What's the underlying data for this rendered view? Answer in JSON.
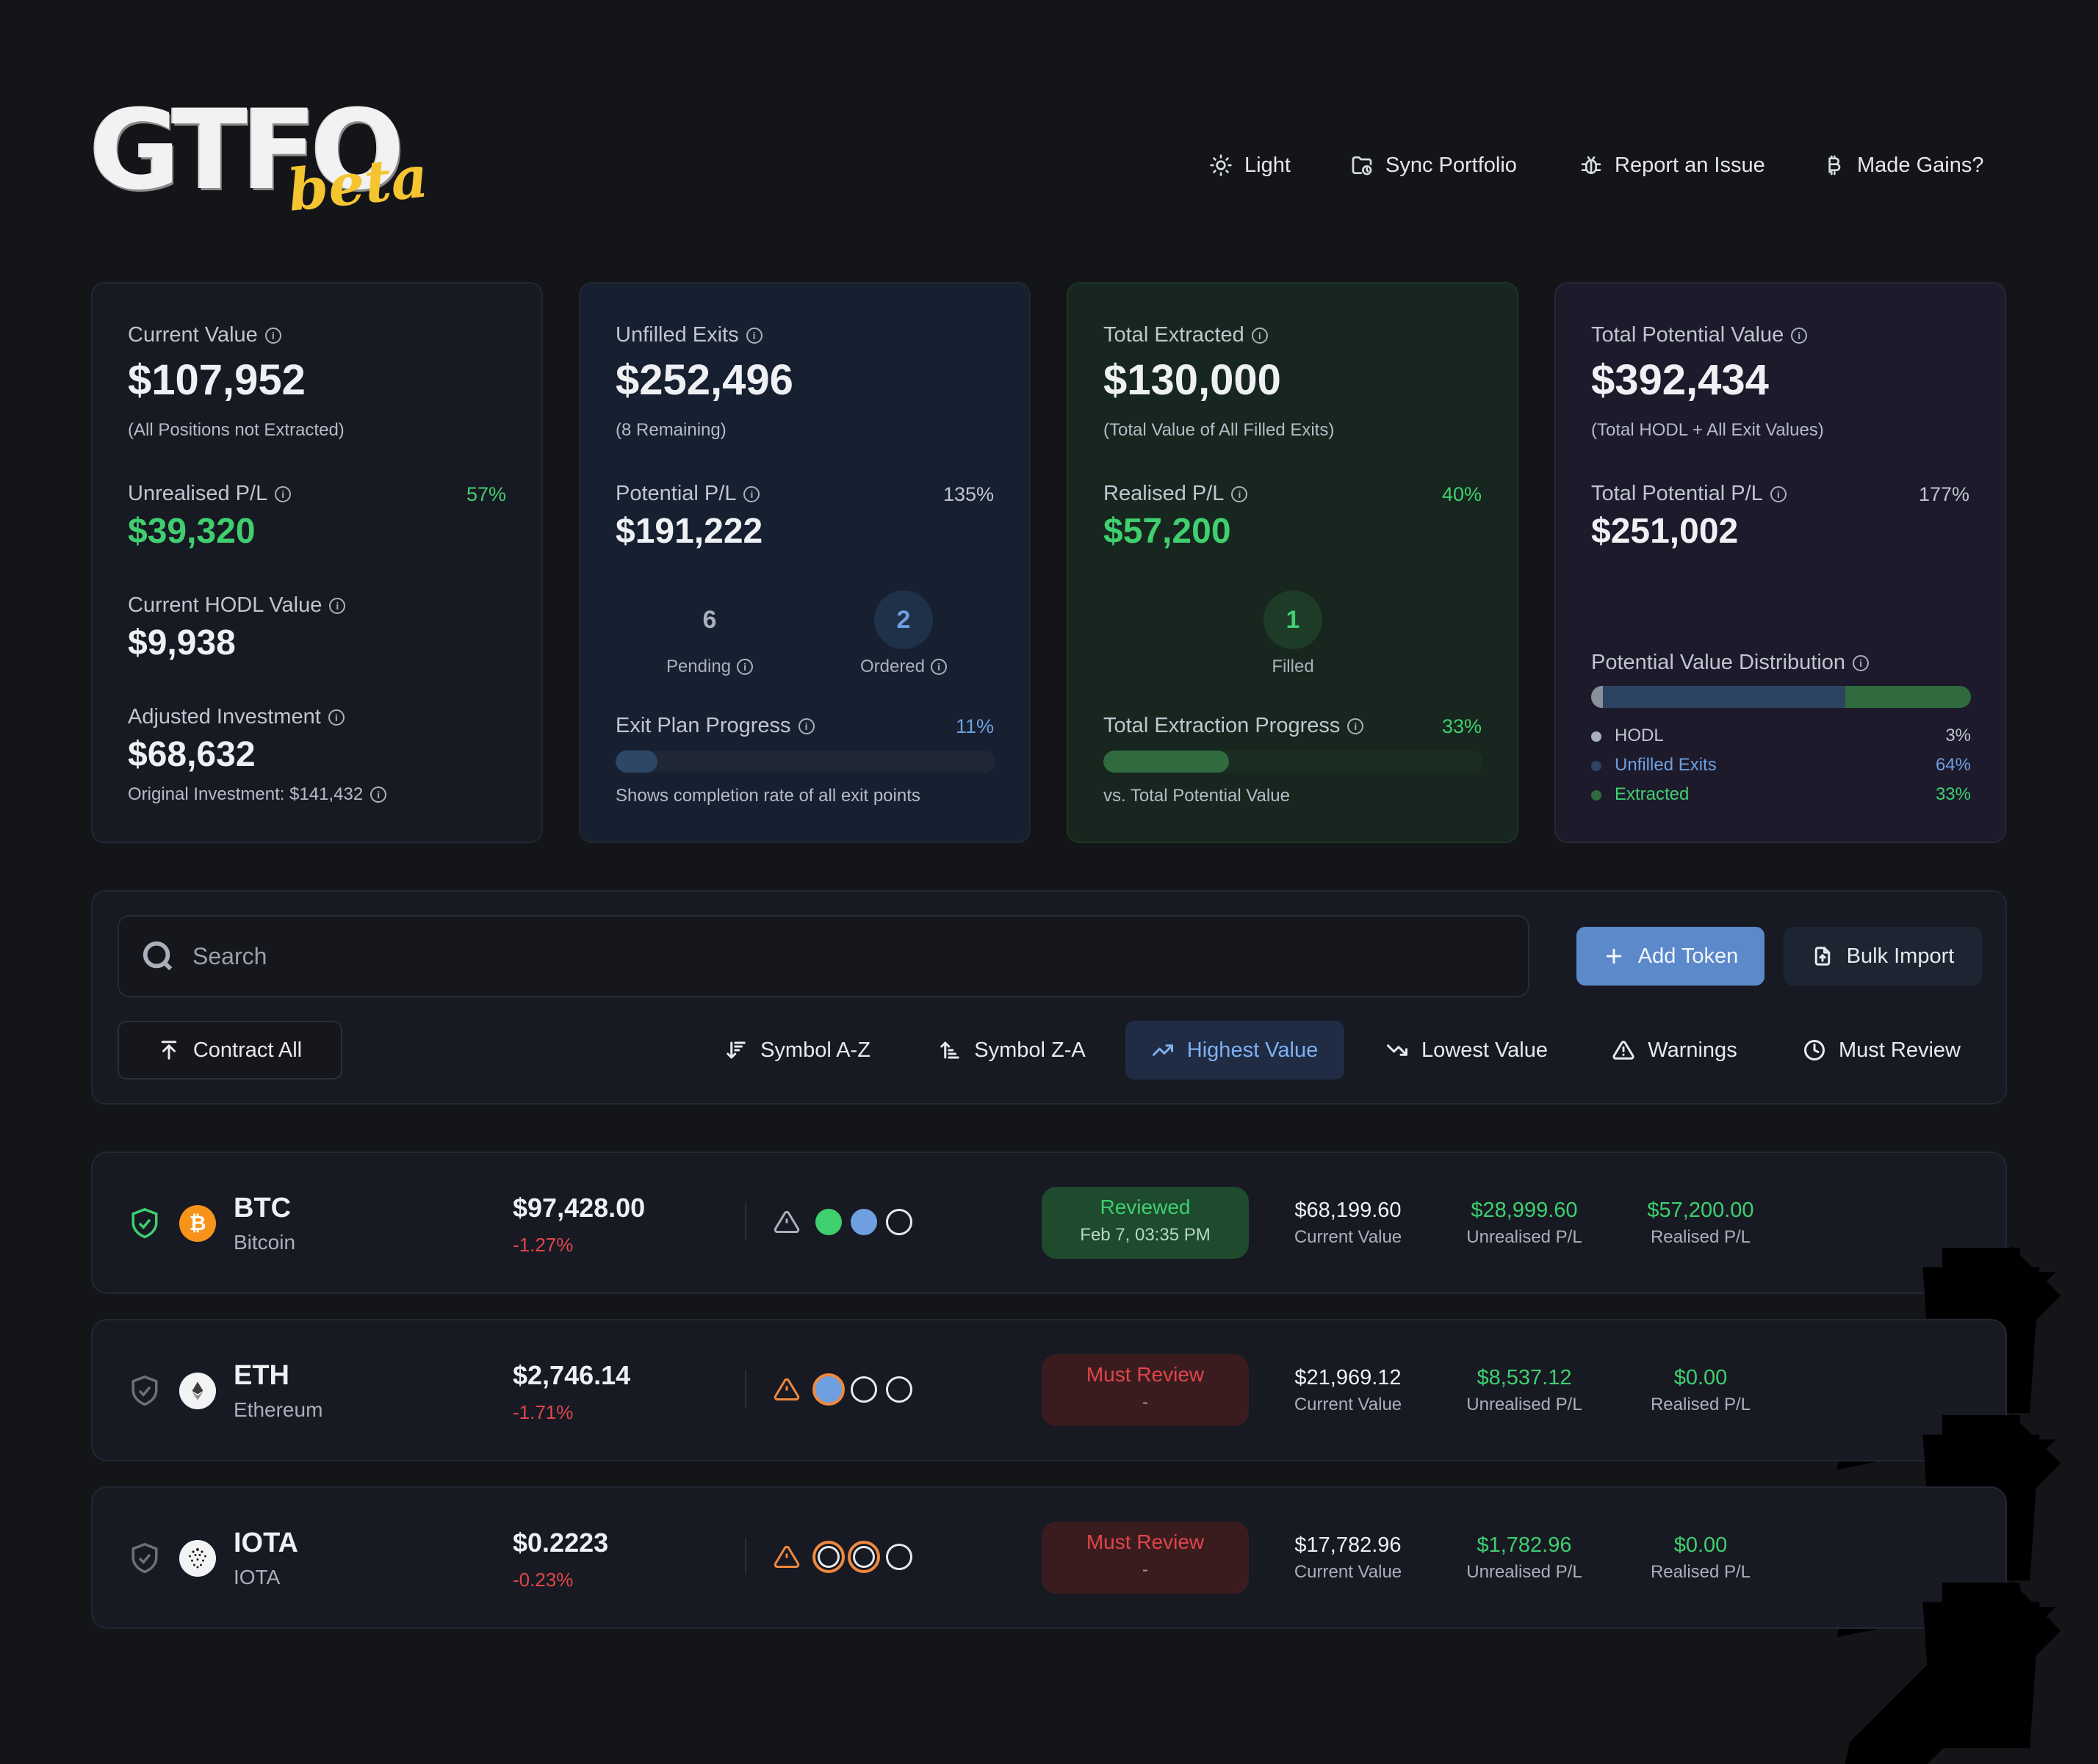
{
  "header": {
    "logo_text": "GTFO",
    "logo_badge": "beta",
    "nav": [
      {
        "label": "Light",
        "icon": "sun-icon"
      },
      {
        "label": "Sync Portfolio",
        "icon": "folder-sync-icon"
      },
      {
        "label": "Report an Issue",
        "icon": "bug-icon"
      },
      {
        "label": "Made Gains?",
        "icon": "bitcoin-icon"
      }
    ]
  },
  "cards": {
    "current": {
      "title": "Current Value",
      "value": "$107,952",
      "note": "(All Positions not Extracted)",
      "unrealised_label": "Unrealised P/L",
      "unrealised_value": "$39,320",
      "unrealised_pct": "57%",
      "hodl_label": "Current HODL Value",
      "hodl_value": "$9,938",
      "adjusted_label": "Adjusted Investment",
      "adjusted_value": "$68,632",
      "original": "Original Investment: $141,432"
    },
    "unfilled": {
      "title": "Unfilled Exits",
      "value": "$252,496",
      "note": "(8 Remaining)",
      "pl_label": "Potential P/L",
      "pl_value": "$191,222",
      "pl_pct": "135%",
      "pending_count": "6",
      "pending_label": "Pending",
      "ordered_count": "2",
      "ordered_label": "Ordered",
      "progress_label": "Exit Plan Progress",
      "progress_pct": "11%",
      "progress_fraction": 0.11,
      "progress_note": "Shows completion rate of all exit points"
    },
    "extracted": {
      "title": "Total Extracted",
      "value": "$130,000",
      "note": "(Total Value of All Filled Exits)",
      "pl_label": "Realised P/L",
      "pl_value": "$57,200",
      "pl_pct": "40%",
      "filled_count": "1",
      "filled_label": "Filled",
      "progress_label": "Total Extraction Progress",
      "progress_pct": "33%",
      "progress_fraction": 0.33,
      "progress_note": "vs. Total Potential Value"
    },
    "potential": {
      "title": "Total Potential Value",
      "value": "$392,434",
      "note": "(Total HODL + All Exit Values)",
      "pl_label": "Total Potential P/L",
      "pl_value": "$251,002",
      "pl_pct": "177%",
      "dist_label": "Potential Value Distribution",
      "dist": [
        {
          "name": "HODL",
          "pct": "3%",
          "fraction": 0.03,
          "color": "#8a8f99"
        },
        {
          "name": "Unfilled Exits",
          "pct": "64%",
          "fraction": 0.64,
          "color": "#2c4461"
        },
        {
          "name": "Extracted",
          "pct": "33%",
          "fraction": 0.33,
          "color": "#2f6b3f"
        }
      ]
    }
  },
  "toolbar": {
    "search_placeholder": "Search",
    "add_label": "Add Token",
    "bulk_label": "Bulk Import",
    "contract_label": "Contract All",
    "sorts": [
      {
        "label": "Symbol A-Z",
        "icon": "sort-asc-icon",
        "active": false
      },
      {
        "label": "Symbol Z-A",
        "icon": "sort-desc-icon",
        "active": false
      },
      {
        "label": "Highest Value",
        "icon": "trending-up-icon",
        "active": true
      },
      {
        "label": "Lowest Value",
        "icon": "trending-down-icon",
        "active": false
      },
      {
        "label": "Warnings",
        "icon": "warning-icon",
        "active": false
      },
      {
        "label": "Must Review",
        "icon": "clock-icon",
        "active": false
      }
    ]
  },
  "tokens": [
    {
      "symbol": "BTC",
      "name": "Bitcoin",
      "price": "$97,428.00",
      "change": "-1.27%",
      "status": "Reviewed",
      "status_date": "Feb 7, 03:35 PM",
      "current_value": "$68,199.60",
      "current_label": "Current Value",
      "unrealised": "$28,999.60",
      "unrealised_label": "Unrealised P/L",
      "realised": "$57,200.00",
      "realised_label": "Realised P/L"
    },
    {
      "symbol": "ETH",
      "name": "Ethereum",
      "price": "$2,746.14",
      "change": "-1.71%",
      "status": "Must Review",
      "status_date": "-",
      "current_value": "$21,969.12",
      "current_label": "Current Value",
      "unrealised": "$8,537.12",
      "unrealised_label": "Unrealised P/L",
      "realised": "$0.00",
      "realised_label": "Realised P/L"
    },
    {
      "symbol": "IOTA",
      "name": "IOTA",
      "price": "$0.2223",
      "change": "-0.23%",
      "status": "Must Review",
      "status_date": "-",
      "current_value": "$17,782.96",
      "current_label": "Current Value",
      "unrealised": "$1,782.96",
      "unrealised_label": "Unrealised P/L",
      "realised": "$0.00",
      "realised_label": "Realised P/L"
    }
  ],
  "colors": {
    "accent": "#5b89c9",
    "positive": "#3fcf6f",
    "negative": "#e0454b",
    "warning": "#f0883e",
    "review_bg": "#1e4a2e",
    "must_review_bg": "#3a1c1f"
  }
}
